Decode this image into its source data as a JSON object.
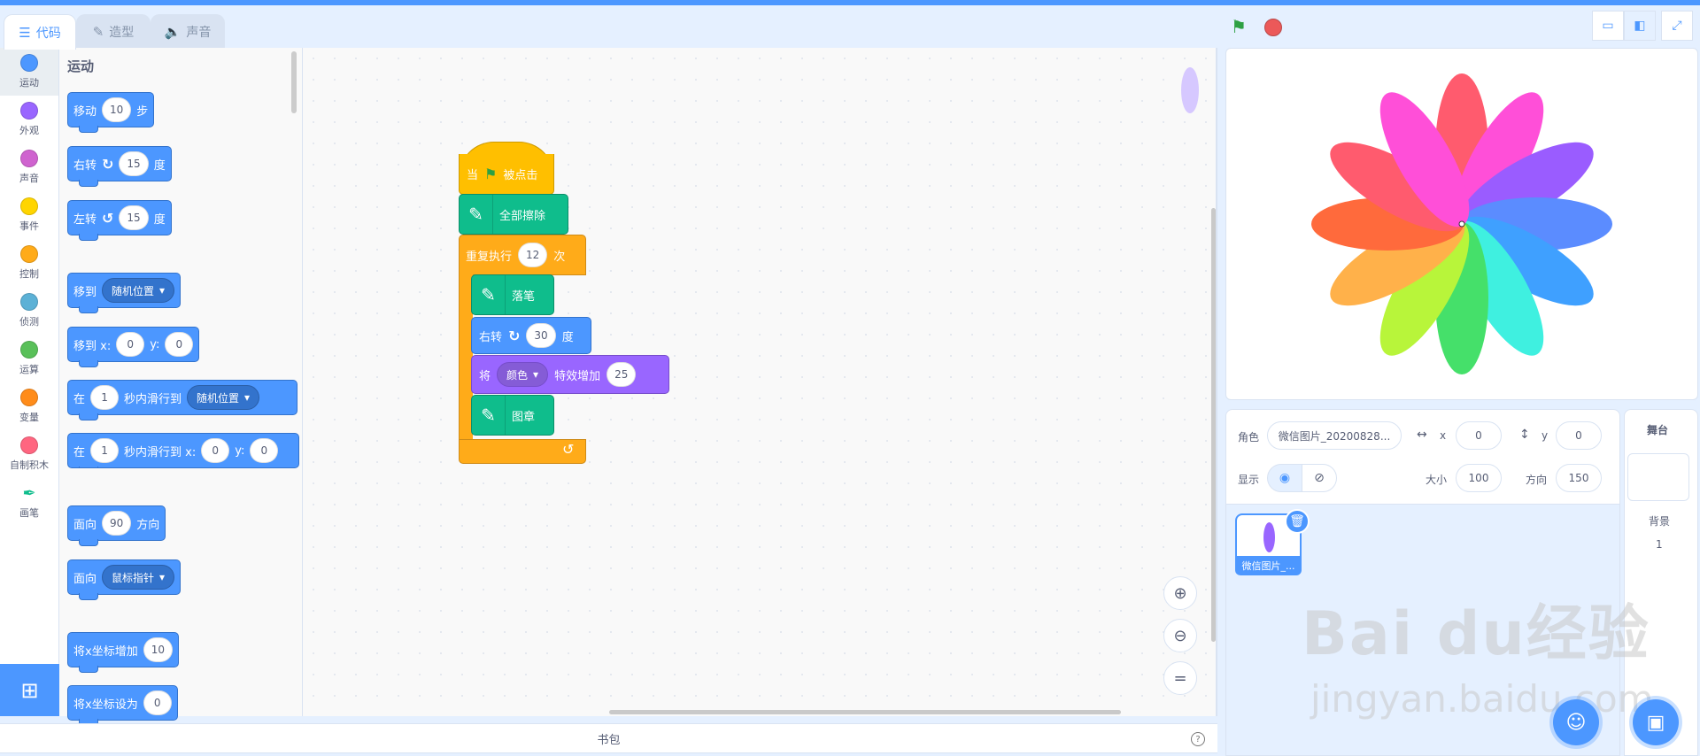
{
  "tabs": [
    {
      "label": "代码",
      "icon": "code-icon"
    },
    {
      "label": "造型",
      "icon": "brush-icon"
    },
    {
      "label": "声音",
      "icon": "speaker-icon"
    }
  ],
  "categories": [
    {
      "label": "运动",
      "color": "#4c97ff"
    },
    {
      "label": "外观",
      "color": "#9966ff"
    },
    {
      "label": "声音",
      "color": "#cf63cf"
    },
    {
      "label": "事件",
      "color": "#ffd500"
    },
    {
      "label": "控制",
      "color": "#ffab19"
    },
    {
      "label": "侦测",
      "color": "#5cb1d6"
    },
    {
      "label": "运算",
      "color": "#59c059"
    },
    {
      "label": "变量",
      "color": "#ff8c1a"
    },
    {
      "label": "自制积木",
      "color": "#ff6680"
    },
    {
      "label": "画笔",
      "color": "#0fbd8c"
    }
  ],
  "palette": {
    "heading": "运动",
    "move": {
      "a": "移动",
      "v": "10",
      "b": "步"
    },
    "turn_right": {
      "a": "右转",
      "v": "15",
      "b": "度"
    },
    "turn_left": {
      "a": "左转",
      "v": "15",
      "b": "度"
    },
    "goto": {
      "a": "移到",
      "dd": "随机位置"
    },
    "goto_xy": {
      "a": "移到 x:",
      "x": "0",
      "b": "y:",
      "y": "0"
    },
    "glide": {
      "a": "在",
      "v": "1",
      "b": "秒内滑行到",
      "dd": "随机位置"
    },
    "glide_xy": {
      "a": "在",
      "v": "1",
      "b": "秒内滑行到 x:",
      "x": "0",
      "c": "y:",
      "y": "0"
    },
    "point_dir": {
      "a": "面向",
      "v": "90",
      "b": "方向"
    },
    "point_towards": {
      "a": "面向",
      "dd": "鼠标指针"
    },
    "change_x": {
      "a": "将x坐标增加",
      "v": "10"
    },
    "set_x": {
      "a": "将x坐标设为",
      "v": "0"
    }
  },
  "script": {
    "hat": {
      "a": "当",
      "b": "被点击"
    },
    "clear": "全部擦除",
    "repeat": {
      "a": "重复执行",
      "v": "12",
      "b": "次"
    },
    "pendown": "落笔",
    "turn": {
      "a": "右转",
      "v": "30",
      "b": "度"
    },
    "effect": {
      "a": "将",
      "dd": "颜色",
      "b": "特效增加",
      "v": "25"
    },
    "stamp": "图章"
  },
  "bag_label": "书包",
  "sprite": {
    "label": "角色",
    "name": "微信图片_20200828...",
    "x_label": "x",
    "x": "0",
    "y_label": "y",
    "y": "0",
    "show_label": "显示",
    "size_label": "大小",
    "size": "100",
    "dir_label": "方向",
    "dir": "150",
    "thumb_name": "微信图片_..."
  },
  "stage_panel": {
    "title": "舞台",
    "backdrop_label": "背景",
    "backdrop_count": "1"
  },
  "watermark": {
    "brand": "Bai du经验",
    "url": "jingyan.baidu.com"
  },
  "petal_colors": [
    "#ff5b6e",
    "#ff4fd8",
    "#9a5cff",
    "#5b8cff",
    "#3fa0ff",
    "#3ff0e0",
    "#45e06a",
    "#b8f53a",
    "#ffb14a",
    "#ff6a3c"
  ]
}
